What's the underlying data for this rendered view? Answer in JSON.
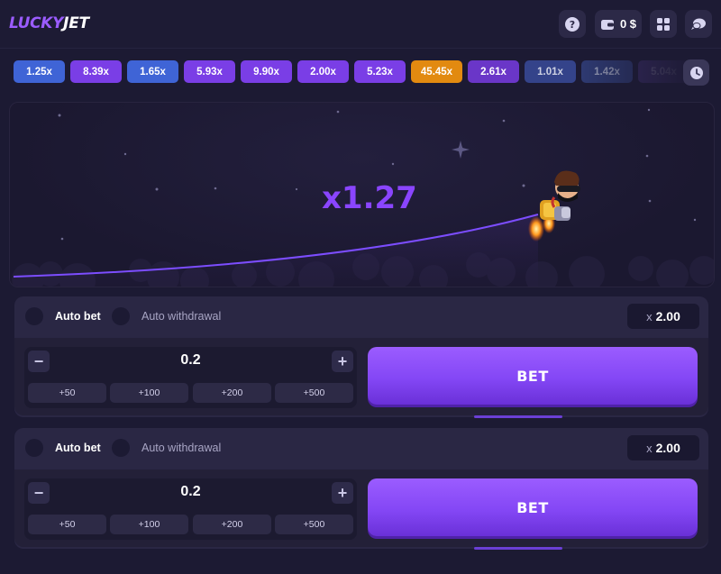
{
  "header": {
    "logo_lucky": "LUCKY",
    "logo_jet": "JET",
    "balance": "0 $",
    "icons": [
      "help-icon",
      "wallet-icon",
      "menu-grid-icon",
      "chat-icon"
    ]
  },
  "history": [
    {
      "label": "1.25x",
      "color": "#3f64d6"
    },
    {
      "label": "8.39x",
      "color": "#7a3ee6"
    },
    {
      "label": "1.65x",
      "color": "#3f64d6"
    },
    {
      "label": "5.93x",
      "color": "#7a3ee6"
    },
    {
      "label": "9.90x",
      "color": "#7a3ee6"
    },
    {
      "label": "2.00x",
      "color": "#7a3ee6"
    },
    {
      "label": "5.23x",
      "color": "#7a3ee6"
    },
    {
      "label": "45.45x",
      "color": "#e28a10"
    },
    {
      "label": "2.61x",
      "color": "#6a36c8"
    },
    {
      "label": "1.01x",
      "color": "#34438a"
    },
    {
      "label": "1.42x",
      "color": "#2e3a72"
    },
    {
      "label": "5.04x",
      "color": "#3a2c66"
    }
  ],
  "game": {
    "multiplier": "x1.27"
  },
  "bets": [
    {
      "auto_bet_label": "Auto bet",
      "auto_withdrawal_label": "Auto withdrawal",
      "cashout_prefix": "x",
      "cashout_value": "2.00",
      "stake": "0.2",
      "minus": "−",
      "plus": "+",
      "quick": [
        "+50",
        "+100",
        "+200",
        "+500"
      ],
      "bet_label": "BET"
    },
    {
      "auto_bet_label": "Auto bet",
      "auto_withdrawal_label": "Auto withdrawal",
      "cashout_prefix": "x",
      "cashout_value": "2.00",
      "stake": "0.2",
      "minus": "−",
      "plus": "+",
      "quick": [
        "+50",
        "+100",
        "+200",
        "+500"
      ],
      "bet_label": "BET"
    }
  ],
  "colors": {
    "accent": "#8a45ff",
    "background": "#1c1a33",
    "panel": "#2a2744"
  }
}
